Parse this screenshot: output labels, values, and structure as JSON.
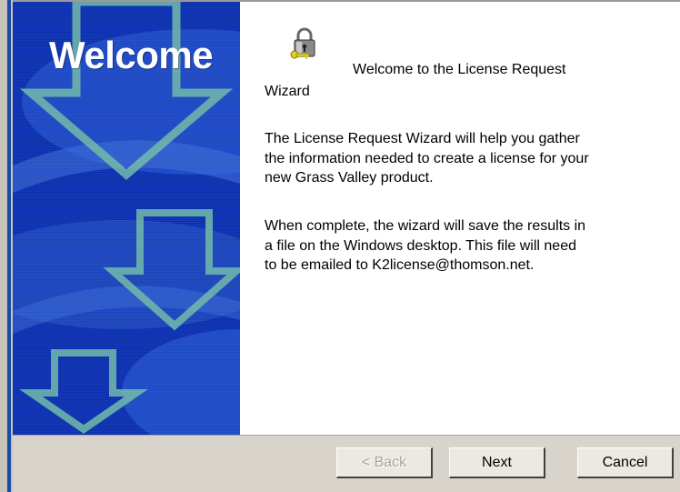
{
  "banner": {
    "title": "Welcome"
  },
  "main": {
    "icon": "lock-key-icon",
    "heading_line1": "Welcome to the License Request",
    "heading_line2": "Wizard",
    "paragraph1": [
      "The License Request Wizard will help you gather",
      "the information needed to create a license for your",
      "new Grass Valley product."
    ],
    "paragraph2": [
      "When complete, the wizard will save the results in",
      "a file on the Windows desktop. This file will need",
      "to be emailed to K2license@thomson.net."
    ]
  },
  "footer": {
    "back_label": "< Back",
    "next_label": "Next",
    "cancel_label": "Cancel",
    "back_enabled": false
  },
  "colors": {
    "banner_blue": "#0b2fb0",
    "arrow_teal": "#6fb9a8",
    "footer_bg": "#d8d4cc"
  }
}
